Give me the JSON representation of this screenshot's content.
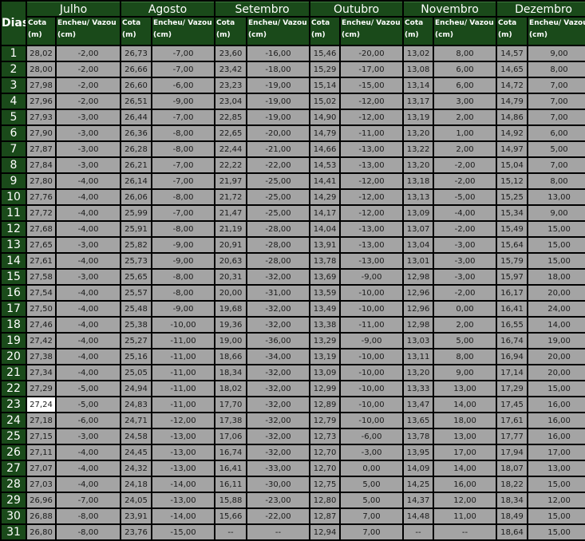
{
  "header": {
    "dias": "Dias",
    "months": [
      "Julho",
      "Agosto",
      "Setembro",
      "Outubro",
      "Novembro",
      "Dezembro"
    ],
    "cota_label": "Cota",
    "cota_unit": "(m)",
    "encheu_label": "Encheu/ Vazou",
    "encheu_unit": "(cm)"
  },
  "highlighted": {
    "day": 23,
    "month": 0,
    "field": "cota"
  },
  "rows": [
    [
      "1",
      "28,02",
      "-2,00",
      "26,73",
      "-7,00",
      "23,60",
      "-16,00",
      "15,46",
      "-20,00",
      "13,02",
      "8,00",
      "14,57",
      "9,00"
    ],
    [
      "2",
      "28,00",
      "-2,00",
      "26,66",
      "-7,00",
      "23,42",
      "-18,00",
      "15,29",
      "-17,00",
      "13,08",
      "6,00",
      "14,65",
      "8,00"
    ],
    [
      "3",
      "27,98",
      "-2,00",
      "26,60",
      "-6,00",
      "23,23",
      "-19,00",
      "15,14",
      "-15,00",
      "13,14",
      "6,00",
      "14,72",
      "7,00"
    ],
    [
      "4",
      "27,96",
      "-2,00",
      "26,51",
      "-9,00",
      "23,04",
      "-19,00",
      "15,02",
      "-12,00",
      "13,17",
      "3,00",
      "14,79",
      "7,00"
    ],
    [
      "5",
      "27,93",
      "-3,00",
      "26,44",
      "-7,00",
      "22,85",
      "-19,00",
      "14,90",
      "-12,00",
      "13,19",
      "2,00",
      "14,86",
      "7,00"
    ],
    [
      "6",
      "27,90",
      "-3,00",
      "26,36",
      "-8,00",
      "22,65",
      "-20,00",
      "14,79",
      "-11,00",
      "13,20",
      "1,00",
      "14,92",
      "6,00"
    ],
    [
      "7",
      "27,87",
      "-3,00",
      "26,28",
      "-8,00",
      "22,44",
      "-21,00",
      "14,66",
      "-13,00",
      "13,22",
      "2,00",
      "14,97",
      "5,00"
    ],
    [
      "8",
      "27,84",
      "-3,00",
      "26,21",
      "-7,00",
      "22,22",
      "-22,00",
      "14,53",
      "-13,00",
      "13,20",
      "-2,00",
      "15,04",
      "7,00"
    ],
    [
      "9",
      "27,80",
      "-4,00",
      "26,14",
      "-7,00",
      "21,97",
      "-25,00",
      "14,41",
      "-12,00",
      "13,18",
      "-2,00",
      "15,12",
      "8,00"
    ],
    [
      "10",
      "27,76",
      "-4,00",
      "26,06",
      "-8,00",
      "21,72",
      "-25,00",
      "14,29",
      "-12,00",
      "13,13",
      "-5,00",
      "15,25",
      "13,00"
    ],
    [
      "11",
      "27,72",
      "-4,00",
      "25,99",
      "-7,00",
      "21,47",
      "-25,00",
      "14,17",
      "-12,00",
      "13,09",
      "-4,00",
      "15,34",
      "9,00"
    ],
    [
      "12",
      "27,68",
      "-4,00",
      "25,91",
      "-8,00",
      "21,19",
      "-28,00",
      "14,04",
      "-13,00",
      "13,07",
      "-2,00",
      "15,49",
      "15,00"
    ],
    [
      "13",
      "27,65",
      "-3,00",
      "25,82",
      "-9,00",
      "20,91",
      "-28,00",
      "13,91",
      "-13,00",
      "13,04",
      "-3,00",
      "15,64",
      "15,00"
    ],
    [
      "14",
      "27,61",
      "-4,00",
      "25,73",
      "-9,00",
      "20,63",
      "-28,00",
      "13,78",
      "-13,00",
      "13,01",
      "-3,00",
      "15,79",
      "15,00"
    ],
    [
      "15",
      "27,58",
      "-3,00",
      "25,65",
      "-8,00",
      "20,31",
      "-32,00",
      "13,69",
      "-9,00",
      "12,98",
      "-3,00",
      "15,97",
      "18,00"
    ],
    [
      "16",
      "27,54",
      "-4,00",
      "25,57",
      "-8,00",
      "20,00",
      "-31,00",
      "13,59",
      "-10,00",
      "12,96",
      "-2,00",
      "16,17",
      "20,00"
    ],
    [
      "17",
      "27,50",
      "-4,00",
      "25,48",
      "-9,00",
      "19,68",
      "-32,00",
      "13,49",
      "-10,00",
      "12,96",
      "0,00",
      "16,41",
      "24,00"
    ],
    [
      "18",
      "27,46",
      "-4,00",
      "25,38",
      "-10,00",
      "19,36",
      "-32,00",
      "13,38",
      "-11,00",
      "12,98",
      "2,00",
      "16,55",
      "14,00"
    ],
    [
      "19",
      "27,42",
      "-4,00",
      "25,27",
      "-11,00",
      "19,00",
      "-36,00",
      "13,29",
      "-9,00",
      "13,03",
      "5,00",
      "16,74",
      "19,00"
    ],
    [
      "20",
      "27,38",
      "-4,00",
      "25,16",
      "-11,00",
      "18,66",
      "-34,00",
      "13,19",
      "-10,00",
      "13,11",
      "8,00",
      "16,94",
      "20,00"
    ],
    [
      "21",
      "27,34",
      "-4,00",
      "25,05",
      "-11,00",
      "18,34",
      "-32,00",
      "13,09",
      "-10,00",
      "13,20",
      "9,00",
      "17,14",
      "20,00"
    ],
    [
      "22",
      "27,29",
      "-5,00",
      "24,94",
      "-11,00",
      "18,02",
      "-32,00",
      "12,99",
      "-10,00",
      "13,33",
      "13,00",
      "17,29",
      "15,00"
    ],
    [
      "23",
      "27,24",
      "-5,00",
      "24,83",
      "-11,00",
      "17,70",
      "-32,00",
      "12,89",
      "-10,00",
      "13,47",
      "14,00",
      "17,45",
      "16,00"
    ],
    [
      "24",
      "27,18",
      "-6,00",
      "24,71",
      "-12,00",
      "17,38",
      "-32,00",
      "12,79",
      "-10,00",
      "13,65",
      "18,00",
      "17,61",
      "16,00"
    ],
    [
      "25",
      "27,15",
      "-3,00",
      "24,58",
      "-13,00",
      "17,06",
      "-32,00",
      "12,73",
      "-6,00",
      "13,78",
      "13,00",
      "17,77",
      "16,00"
    ],
    [
      "26",
      "27,11",
      "-4,00",
      "24,45",
      "-13,00",
      "16,74",
      "-32,00",
      "12,70",
      "-3,00",
      "13,95",
      "17,00",
      "17,94",
      "17,00"
    ],
    [
      "27",
      "27,07",
      "-4,00",
      "24,32",
      "-13,00",
      "16,41",
      "-33,00",
      "12,70",
      "0,00",
      "14,09",
      "14,00",
      "18,07",
      "13,00"
    ],
    [
      "28",
      "27,03",
      "-4,00",
      "24,18",
      "-14,00",
      "16,11",
      "-30,00",
      "12,75",
      "5,00",
      "14,25",
      "16,00",
      "18,22",
      "15,00"
    ],
    [
      "29",
      "26,96",
      "-7,00",
      "24,05",
      "-13,00",
      "15,88",
      "-23,00",
      "12,80",
      "5,00",
      "14,37",
      "12,00",
      "18,34",
      "12,00"
    ],
    [
      "30",
      "26,88",
      "-8,00",
      "23,91",
      "-14,00",
      "15,66",
      "-22,00",
      "12,87",
      "7,00",
      "14,48",
      "11,00",
      "18,49",
      "15,00"
    ],
    [
      "31",
      "26,80",
      "-8,00",
      "23,76",
      "-15,00",
      "--",
      "--",
      "12,94",
      "7,00",
      "--",
      "--",
      "18,64",
      "15,00"
    ]
  ]
}
